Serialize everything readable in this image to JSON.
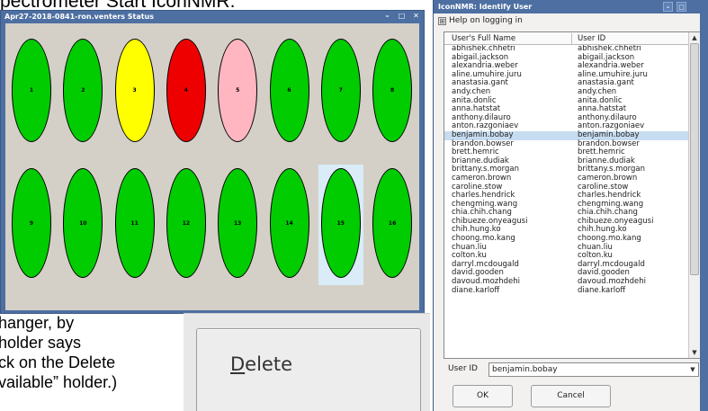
{
  "background": {
    "title_partial": "pectrometer Start IconNMR.",
    "lines": [
      "hanger, by",
      "holder says",
      "ck on the Delete",
      "vailable” holder.)"
    ]
  },
  "status_window": {
    "title": "Apr27-2018-0841-ron.venters Status",
    "controls": [
      "–",
      "□",
      "✕"
    ],
    "selected_slot": "15",
    "samples": [
      {
        "label": "1",
        "color": "#00cc00"
      },
      {
        "label": "2",
        "color": "#00cc00"
      },
      {
        "label": "3",
        "color": "#ffff00"
      },
      {
        "label": "4",
        "color": "#ee0000"
      },
      {
        "label": "5",
        "color": "#ffb6c1"
      },
      {
        "label": "6",
        "color": "#00cc00"
      },
      {
        "label": "7",
        "color": "#00cc00"
      },
      {
        "label": "8",
        "color": "#00cc00"
      },
      {
        "label": "9",
        "color": "#00cc00"
      },
      {
        "label": "10",
        "color": "#00cc00"
      },
      {
        "label": "11",
        "color": "#00cc00"
      },
      {
        "label": "12",
        "color": "#00cc00"
      },
      {
        "label": "13",
        "color": "#00cc00"
      },
      {
        "label": "14",
        "color": "#00cc00"
      },
      {
        "label": "15",
        "color": "#00cc00"
      },
      {
        "label": "16",
        "color": "#00cc00"
      }
    ]
  },
  "delete_button": {
    "mnemonic": "D",
    "label_rest": "elete"
  },
  "identify_dialog": {
    "title": "IconNMR: Identify User",
    "controls": [
      "–",
      "□"
    ],
    "help_toggle": "⊞",
    "help_label": "Help on logging in",
    "columns": [
      "User's Full Name",
      "User ID"
    ],
    "selected_index": 11,
    "users": [
      [
        "abhishek.chhetri",
        "abhishek.chhetri"
      ],
      [
        "abigail.jackson",
        "abigail.jackson"
      ],
      [
        "alexandria.weber",
        "alexandria.weber"
      ],
      [
        "aline.umuhire.juru",
        "aline.umuhire.juru"
      ],
      [
        "anastasia.gant",
        "anastasia.gant"
      ],
      [
        "andy.chen",
        "andy.chen"
      ],
      [
        "anita.donlic",
        "anita.donlic"
      ],
      [
        "anna.hatstat",
        "anna.hatstat"
      ],
      [
        "anthony.dilauro",
        "anthony.dilauro"
      ],
      [
        "anton.razgoniaev",
        "anton.razgoniaev"
      ],
      [
        "benjamin.bobay",
        "benjamin.bobay"
      ],
      [
        "brandon.bowser",
        "brandon.bowser"
      ],
      [
        "brett.hemric",
        "brett.hemric"
      ],
      [
        "brianne.dudiak",
        "brianne.dudiak"
      ],
      [
        "brittany.s.morgan",
        "brittany.s.morgan"
      ],
      [
        "cameron.brown",
        "cameron.brown"
      ],
      [
        "caroline.stow",
        "caroline.stow"
      ],
      [
        "charles.hendrick",
        "charles.hendrick"
      ],
      [
        "chengming.wang",
        "chengming.wang"
      ],
      [
        "chia.chih.chang",
        "chia.chih.chang"
      ],
      [
        "chibueze.onyeagusi",
        "chibueze.onyeagusi"
      ],
      [
        "chih.hung.ko",
        "chih.hung.ko"
      ],
      [
        "choong.mo.kang",
        "choong.mo.kang"
      ],
      [
        "chuan.liu",
        "chuan.liu"
      ],
      [
        "colton.ku",
        "colton.ku"
      ],
      [
        "darryl.mcdougald",
        "darryl.mcdougald"
      ],
      [
        "david.gooden",
        "david.gooden"
      ],
      [
        "davoud.mozhdehi",
        "davoud.mozhdehi"
      ],
      [
        "diane.karloff",
        "diane.karloff"
      ]
    ],
    "userid_label": "User ID",
    "userid_value": "benjamin.bobay",
    "ok_label": "OK",
    "cancel_label": "Cancel"
  }
}
